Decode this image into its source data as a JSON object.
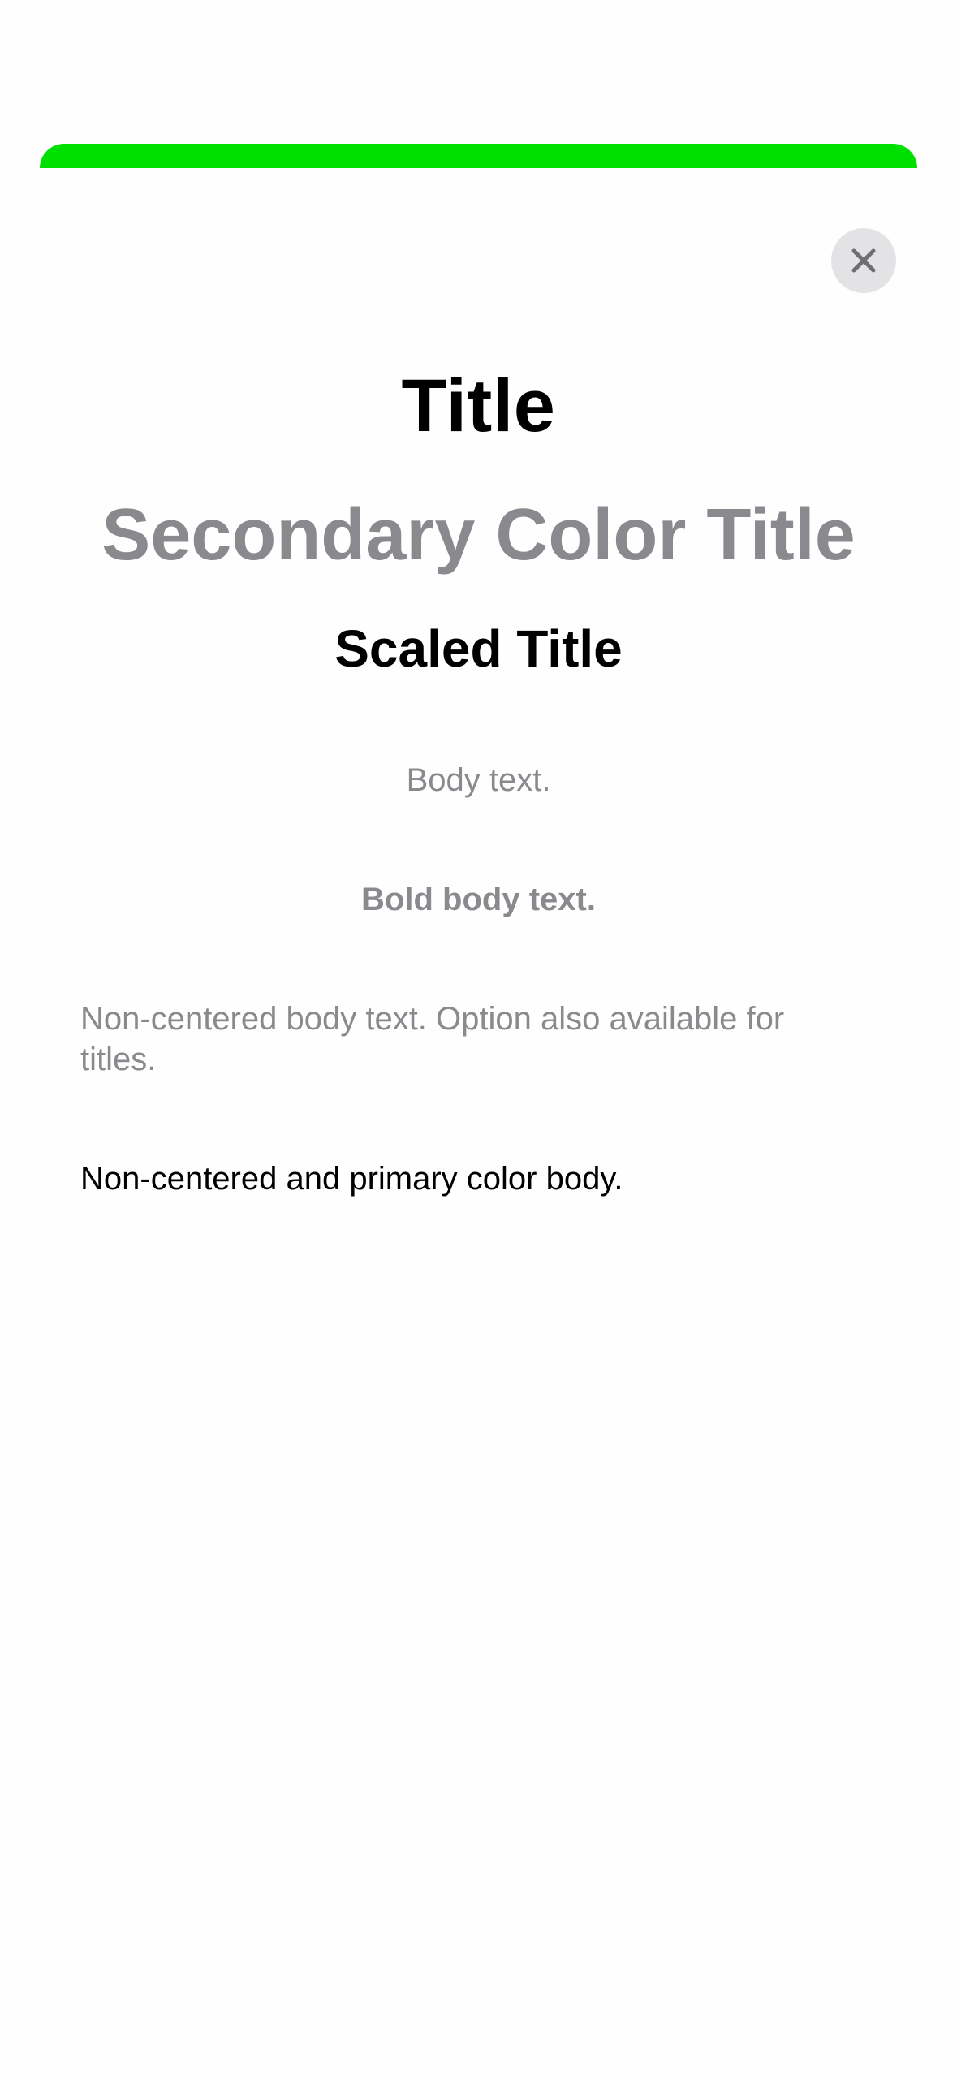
{
  "colors": {
    "accent": "#00e000",
    "background": "#fefefe",
    "primary_text": "#000000",
    "secondary_text": "#8a8a8e",
    "close_button_bg": "#e3e3e6",
    "close_icon": "#6e6e73"
  },
  "close_button": {
    "icon": "close-icon"
  },
  "content": {
    "title": "Title",
    "secondary_title": "Secondary Color Title",
    "scaled_title": "Scaled Title",
    "body_text": "Body text.",
    "bold_body_text": "Bold body text.",
    "noncentered_body_text": "Non-centered body text. Option also available for titles.",
    "noncentered_primary_body": "Non-centered and primary color body."
  }
}
